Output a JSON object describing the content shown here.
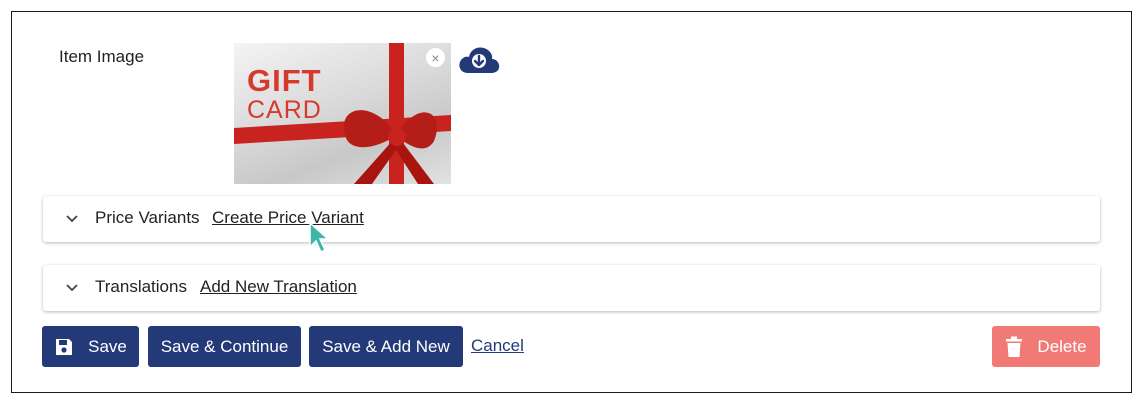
{
  "item_image": {
    "label": "Item Image",
    "image_text_line1": "GIFT",
    "image_text_line2": "CARD",
    "remove_icon": "close-icon",
    "download_icon": "cloud-download-icon"
  },
  "panels": [
    {
      "title": "Price Variants",
      "link": "Create Price Variant",
      "icon": "chevron-down-icon"
    },
    {
      "title": "Translations",
      "link": "Add New Translation",
      "icon": "chevron-down-icon"
    }
  ],
  "actions": {
    "save": "Save",
    "save_continue": "Save & Continue",
    "save_add_new": "Save & Add New",
    "cancel": "Cancel",
    "delete": "Delete"
  },
  "colors": {
    "primary": "#243a78",
    "danger": "#f17a76",
    "ribbon": "#c8231e"
  }
}
